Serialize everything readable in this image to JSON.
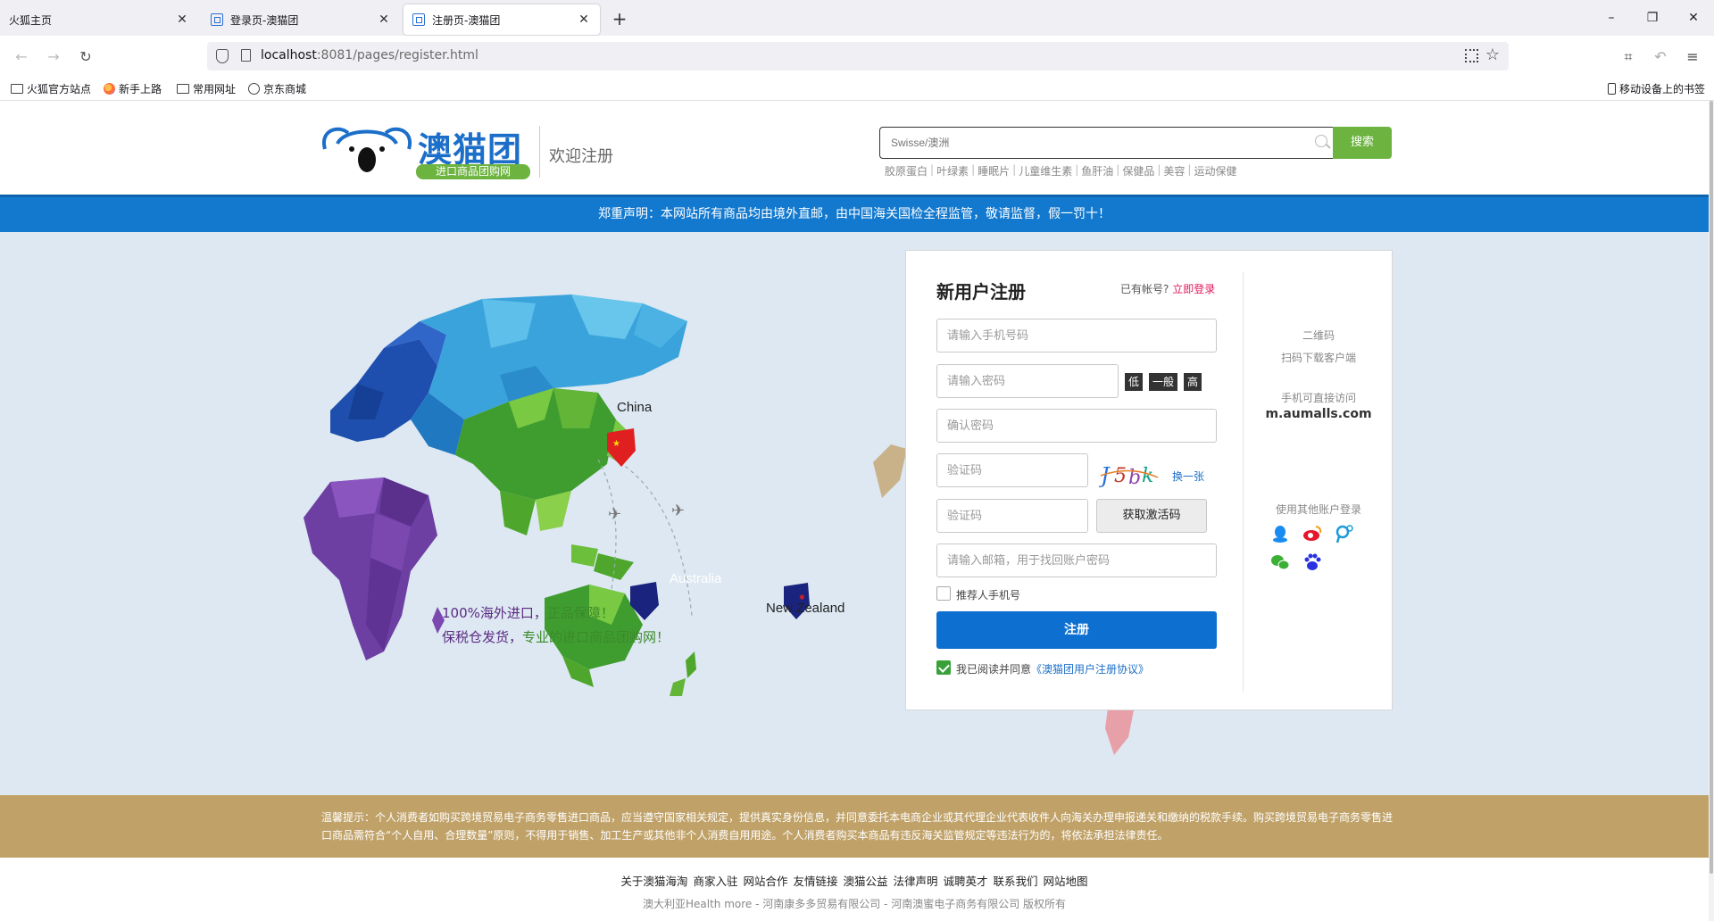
{
  "browser": {
    "tabs": [
      {
        "title": "火狐主页"
      },
      {
        "title": "登录页-澳猫团"
      },
      {
        "title": "注册页-澳猫团"
      }
    ],
    "url_host": "localhost",
    "url_rest": ":8081/pages/register.html",
    "bookmarks": [
      "火狐官方站点",
      "新手上路",
      "常用网址",
      "京东商城"
    ],
    "mobile_bookmarks": "移动设备上的书签"
  },
  "header": {
    "logo_name": "澳猫团",
    "logo_tag": "进口商品团购网",
    "welcome": "欢迎注册",
    "search_placeholder": "Swisse/澳洲",
    "search_button": "搜索",
    "hot_words": [
      "胶原蛋白",
      "叶绿素",
      "睡眠片",
      "儿童维生素",
      "鱼肝油",
      "保健品",
      "美容",
      "运动保健"
    ]
  },
  "notice": "郑重声明：本网站所有商品均由境外直邮，由中国海关国检全程监管，敬请监督，假一罚十！",
  "map": {
    "labels": {
      "china": "China",
      "australia": "Australia",
      "new_zealand": "New Zealand"
    },
    "slogan_1_purple": "100%海外进口，",
    "slogan_1_green": "正品保障！",
    "slogan_2_purple": "保税仓发货，",
    "slogan_2_green": "专业的进口商品团购网！"
  },
  "register": {
    "title": "新用户注册",
    "have_account": "已有帐号?",
    "login_now": "立即登录",
    "phone_placeholder": "请输入手机号码",
    "password_placeholder": "请输入密码",
    "strength": [
      "低",
      "一般",
      "高"
    ],
    "confirm_placeholder": "确认密码",
    "captcha_placeholder": "验证码",
    "captcha_refresh": "换一张",
    "sms_placeholder": "验证码",
    "sms_button": "获取激活码",
    "email_placeholder": "请输入邮箱，用于找回账户密码",
    "referrer_label": "推荐人手机号",
    "referrer_checked": false,
    "submit": "注册",
    "agree_text": "我已阅读并同意",
    "agree_link": "《澳猫团用户注册协议》",
    "agree_checked": true
  },
  "sidebar": {
    "qr_title": "二维码",
    "qr_desc": "扫码下载客户端",
    "mobile_title": "手机可直接访问",
    "mobile_domain": "m.aumalls.com",
    "other_login": "使用其他账户登录",
    "social_icons": [
      "qq-icon",
      "weibo-icon",
      "alipay-icon",
      "wechat-icon",
      "baidu-icon"
    ]
  },
  "tip": "温馨提示：个人消费者如购买跨境贸易电子商务零售进口商品，应当遵守国家相关规定，提供真实身份信息，并同意委托本电商企业或其代理企业代表收件人向海关办理申报递关和缴纳的税款手续。购买跨境贸易电子商务零售进口商品需符合“个人自用、合理数量”原则，不得用于销售、加工生产或其他非个人消费自用用途。个人消费者购买本商品有违反海关监管规定等违法行为的，将依法承担法律责任。",
  "footer": {
    "links": [
      "关于澳猫海淘",
      "商家入驻",
      "网站合作",
      "友情链接",
      "澳猫公益",
      "法律声明",
      "诚聘英才",
      "联系我们",
      "网站地图"
    ],
    "copyright": "澳大利亚Health more - 河南康多多贸易有限公司 - 河南澳蜜电子商务有限公司 版权所有"
  },
  "colors": {
    "brand_blue": "#1279cf",
    "brand_green": "#6cb33f",
    "tip_bg": "#c0a269",
    "login_link": "#e0195f"
  }
}
